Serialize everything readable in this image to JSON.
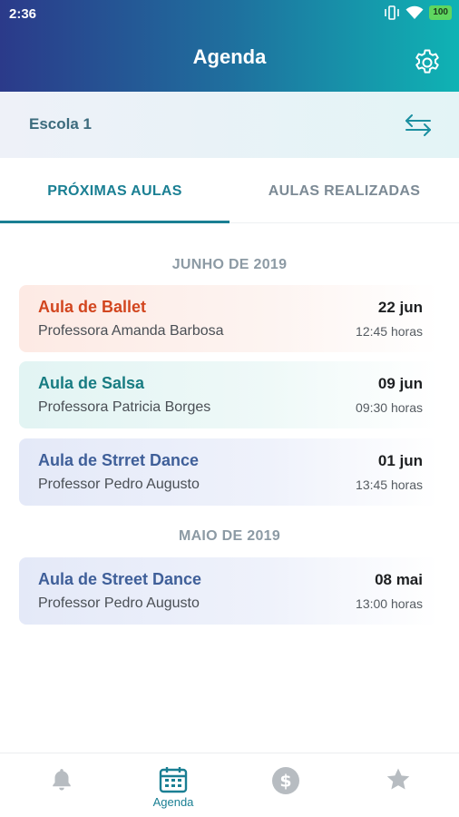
{
  "status": {
    "time": "2:36",
    "battery": "100"
  },
  "header": {
    "title": "Agenda"
  },
  "school": {
    "name": "Escola 1"
  },
  "tabs": [
    {
      "label": "PRÓXIMAS AULAS",
      "active": true
    },
    {
      "label": "AULAS REALIZADAS",
      "active": false
    }
  ],
  "groups": [
    {
      "month": "JUNHO DE 2019",
      "items": [
        {
          "title": "Aula de Ballet",
          "teacher": "Professora Amanda Barbosa",
          "date": "22 jun",
          "time": "12:45 horas",
          "color": "#d2461f"
        },
        {
          "title": "Aula de Salsa",
          "teacher": "Professora Patricia Borges",
          "date": "09 jun",
          "time": "09:30 horas",
          "color": "#187c82"
        },
        {
          "title": "Aula de Strret Dance",
          "teacher": "Professor Pedro Augusto",
          "date": "01 jun",
          "time": "13:45 horas",
          "color": "#3f5f99"
        }
      ]
    },
    {
      "month": "MAIO DE 2019",
      "items": [
        {
          "title": "Aula de Street Dance",
          "teacher": "Professor Pedro Augusto",
          "date": "08 mai",
          "time": "13:00 horas",
          "color": "#3f5f99"
        }
      ]
    }
  ],
  "bottom_nav": {
    "items": [
      {
        "icon": "bell-icon",
        "label": ""
      },
      {
        "icon": "calendar-icon",
        "label": "Agenda",
        "active": true
      },
      {
        "icon": "dollar-icon",
        "label": ""
      },
      {
        "icon": "star-icon",
        "label": ""
      }
    ]
  },
  "colors": {
    "accent": "#1a7f93",
    "inactive_icon": "#b7bcc1"
  }
}
